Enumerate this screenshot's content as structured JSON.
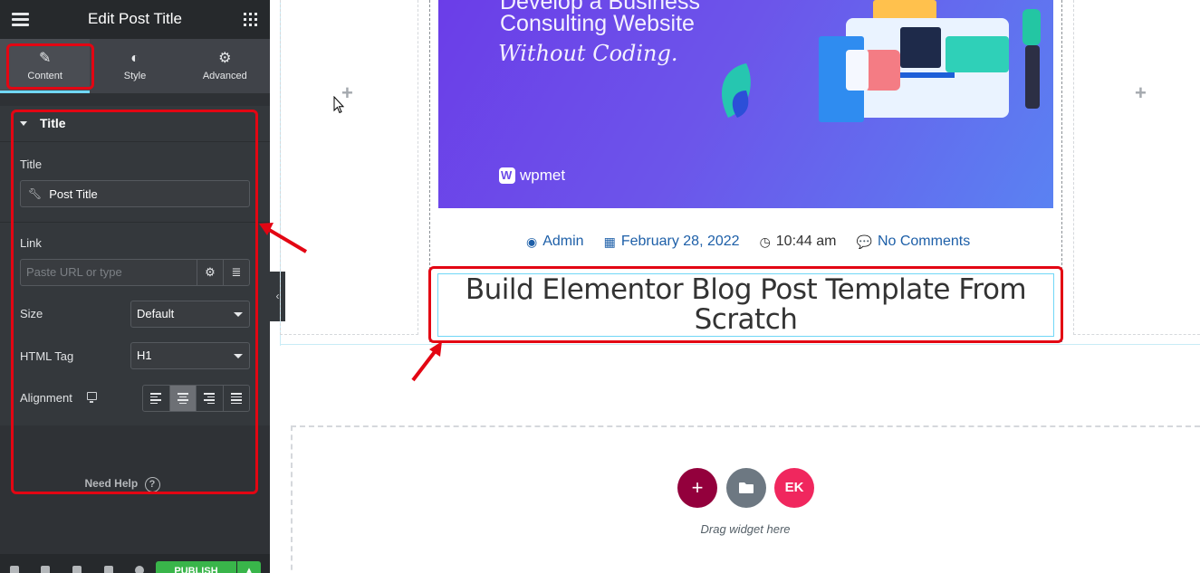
{
  "panel": {
    "title": "Edit Post Title",
    "menu_icon": "hamburger-icon",
    "apps_icon": "grid-icon",
    "tabs": [
      {
        "label": "Content",
        "icon": "pencil-icon",
        "glyph": "✎",
        "active": true
      },
      {
        "label": "Style",
        "icon": "half-circle-icon",
        "glyph": "◐",
        "active": false
      },
      {
        "label": "Advanced",
        "icon": "gear-icon",
        "glyph": "⚙",
        "active": false
      }
    ],
    "section": {
      "title": "Title",
      "expanded": true
    },
    "controls": {
      "title_label": "Title",
      "title_value": "Post Title",
      "title_icon": "wrench-icon",
      "link_label": "Link",
      "link_placeholder": "Paste URL or type",
      "link_settings_glyph": "⚙",
      "link_dynamic_glyph": "≣",
      "size_label": "Size",
      "size_value": "Default",
      "html_tag_label": "HTML Tag",
      "html_tag_value": "H1",
      "alignment_label": "Alignment",
      "alignment_options": [
        "left",
        "center",
        "right",
        "justify"
      ],
      "alignment_selected": "center"
    },
    "need_help": "Need Help",
    "help_glyph": "?",
    "footer": {
      "publish_label": "PUBLISH",
      "publish_more_glyph": "▴"
    },
    "collapse_glyph": "‹"
  },
  "canvas": {
    "hero": {
      "line1": "Develop a Business",
      "line2": "Consulting Website",
      "line3": "Without Coding.",
      "brand": "wpmet"
    },
    "meta": [
      {
        "icon": "user-icon",
        "glyph": "◉",
        "text": "Admin"
      },
      {
        "icon": "calendar-icon",
        "glyph": "▦",
        "text": "February 28, 2022"
      },
      {
        "icon": "clock-icon",
        "glyph": "◷",
        "text": "10:44 am"
      },
      {
        "icon": "comment-icon",
        "glyph": "💬",
        "text": "No Comments"
      }
    ],
    "heading": "Build Elementor Blog Post Template From Scratch",
    "add_glyph": "+",
    "dropzone": {
      "add_glyph": "+",
      "folder_glyph": "▬",
      "ek_glyph": "EK",
      "text": "Drag widget here"
    }
  },
  "colors": {
    "panel_bg": "#34383c",
    "active_tab_indicator": "#71d7f7",
    "publish": "#39b54a",
    "annotation_red": "#e30613",
    "meta_link": "#1d5fa8",
    "add_section": "#93003c",
    "template_library": "#6d7882",
    "elementskit": "#f0275e"
  }
}
